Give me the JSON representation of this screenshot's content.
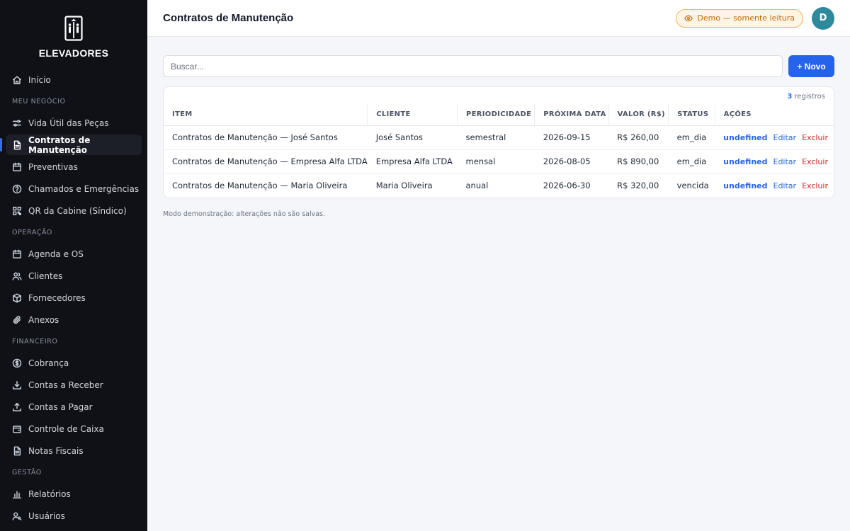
{
  "brand": {
    "name": "ELEVADORES"
  },
  "sidebar": {
    "items": [
      {
        "label": "Início",
        "icon": "home-icon"
      },
      {
        "section": "MEU NEGÓCIO"
      },
      {
        "label": "Vida Útil das Peças",
        "icon": "sliders-icon"
      },
      {
        "label": "Contratos de Manutenção",
        "icon": "document-icon",
        "active": true
      },
      {
        "label": "Preventivas",
        "icon": "calendar-icon"
      },
      {
        "label": "Chamados e Emergências",
        "icon": "help-circle-icon"
      },
      {
        "label": "QR da Cabine (Síndico)",
        "icon": "qr-icon"
      },
      {
        "section": "OPERAÇÃO"
      },
      {
        "label": "Agenda e OS",
        "icon": "calendar-icon"
      },
      {
        "label": "Clientes",
        "icon": "users-icon"
      },
      {
        "label": "Fornecedores",
        "icon": "box-icon"
      },
      {
        "label": "Anexos",
        "icon": "paperclip-icon"
      },
      {
        "section": "FINANCEIRO"
      },
      {
        "label": "Cobrança",
        "icon": "dollar-circle-icon"
      },
      {
        "label": "Contas a Receber",
        "icon": "download-icon"
      },
      {
        "label": "Contas a Pagar",
        "icon": "upload-icon"
      },
      {
        "label": "Controle de Caixa",
        "icon": "wallet-icon"
      },
      {
        "label": "Notas Fiscais",
        "icon": "file-icon"
      },
      {
        "section": "GESTÃO"
      },
      {
        "label": "Relatórios",
        "icon": "bar-chart-icon"
      },
      {
        "label": "Usuários",
        "icon": "user-key-icon"
      }
    ]
  },
  "header": {
    "title": "Contratos de Manutenção",
    "demo_badge": "Demo — somente leitura",
    "avatar_initial": "D"
  },
  "search": {
    "placeholder": "Buscar..."
  },
  "toolbar": {
    "new_label": "+ Novo"
  },
  "table": {
    "count": "3",
    "count_label": " registros",
    "columns": [
      "ITEM",
      "CLIENTE",
      "PERIODICIDADE",
      "PRÓXIMA DATA",
      "VALOR (R$)",
      "STATUS",
      "AÇÕES"
    ],
    "rows": [
      [
        "Contratos de Manutenção — José Santos",
        "José Santos",
        "semestral",
        "2026-09-15",
        "R$ 260,00",
        "em_dia"
      ],
      [
        "Contratos de Manutenção — Empresa Alfa LTDA",
        "Empresa Alfa LTDA",
        "mensal",
        "2026-08-05",
        "R$ 890,00",
        "em_dia"
      ],
      [
        "Contratos de Manutenção — Maria Oliveira",
        "Maria Oliveira",
        "anual",
        "2026-06-30",
        "R$ 320,00",
        "vencida"
      ]
    ],
    "actions": [
      "undefined",
      "Editar",
      "Excluir"
    ]
  },
  "footnote": "Modo demonstração: alterações não são salvas.",
  "colors": {
    "sidebar_bg": "#0f1117",
    "accent": "#2563eb",
    "danger": "#dc2626",
    "badge": "#c26a05",
    "avatar": "#2d8a9c"
  }
}
